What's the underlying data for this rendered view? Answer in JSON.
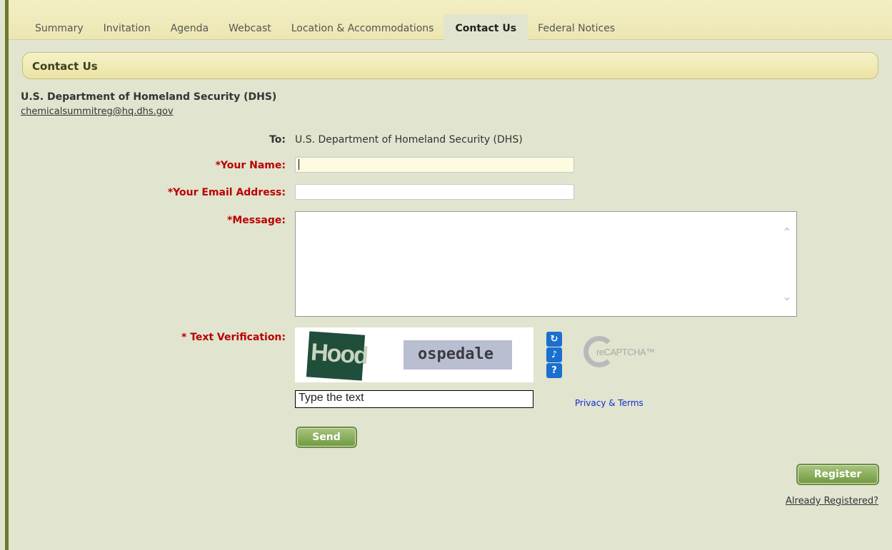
{
  "tabs": [
    {
      "label": "Summary",
      "active": false
    },
    {
      "label": "Invitation",
      "active": false
    },
    {
      "label": "Agenda",
      "active": false
    },
    {
      "label": "Webcast",
      "active": false
    },
    {
      "label": "Location & Accommodations",
      "active": false
    },
    {
      "label": "Contact Us",
      "active": true
    },
    {
      "label": "Federal Notices",
      "active": false
    }
  ],
  "section": {
    "title": "Contact Us"
  },
  "org": {
    "name": "U.S. Department of Homeland Security (DHS)",
    "email": "chemicalsummitreg@hq.dhs.gov"
  },
  "form": {
    "to_label": "To:",
    "to_value": "U.S. Department of Homeland Security (DHS)",
    "name_label": "*Your Name:",
    "name_value": "",
    "email_label": "*Your Email Address:",
    "email_value": "",
    "message_label": "*Message:",
    "message_value": "",
    "verification_label": "* Text Verification:",
    "captcha_words": [
      "Hood",
      "ospedale"
    ],
    "captcha_input_value": "Type the text",
    "captcha_icons": [
      "refresh-icon",
      "audio-icon",
      "help-icon"
    ],
    "recaptcha_brand": "reCAPTCHA™",
    "privacy_link": "Privacy & Terms",
    "send_label": "Send"
  },
  "footer": {
    "register_label": "Register",
    "already_registered": "Already Registered?"
  },
  "colors": {
    "background": "#e1e4cf",
    "required_label": "#bb0000",
    "button": "#7fa44c",
    "tab_bar": "#efeabd"
  }
}
